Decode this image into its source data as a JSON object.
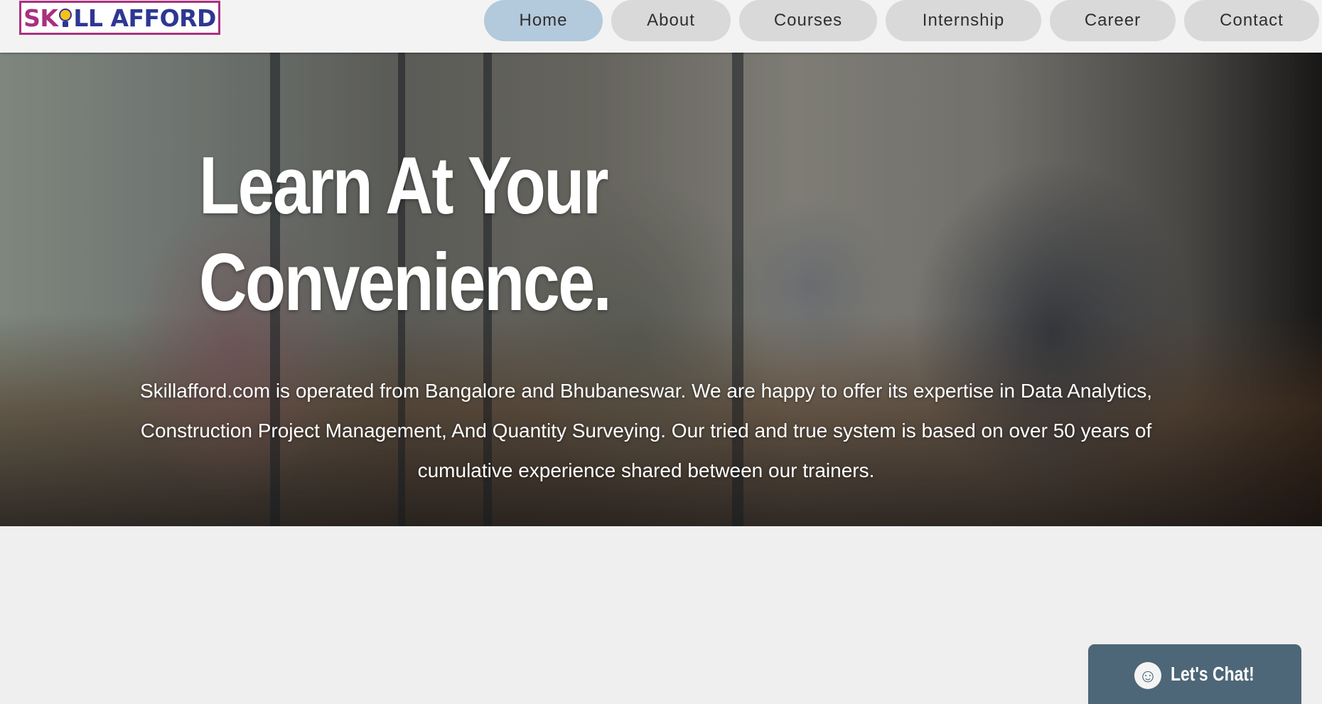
{
  "header": {
    "logo": {
      "part1": "SK",
      "part2": "LL AFFORD",
      "icon": "lightbulb-icon",
      "brand_colors": [
        "#a8317f",
        "#2e3792"
      ]
    },
    "nav": [
      {
        "label": "Home",
        "active": true
      },
      {
        "label": "About",
        "active": false
      },
      {
        "label": "Courses",
        "active": false
      },
      {
        "label": "Internship",
        "active": false
      },
      {
        "label": "Career",
        "active": false
      },
      {
        "label": "Contact",
        "active": false
      }
    ]
  },
  "hero": {
    "title_line1": "Learn At Your",
    "title_line2": "Convenience.",
    "description": "Skillafford.com is operated from Bangalore and Bhubaneswar. We are happy to offer its expertise in Data Analytics, Construction Project Management, And Quantity Surveying. Our tried and true system is based on over 50 years of cumulative experience shared between our trainers."
  },
  "chat": {
    "label": "Let's Chat!",
    "icon": "smiley-chat-icon",
    "color": "#4d6678"
  },
  "colors": {
    "nav_active": "#b3c9dc",
    "nav_inactive": "#d9d9d9",
    "page_bg": "#efefef"
  }
}
